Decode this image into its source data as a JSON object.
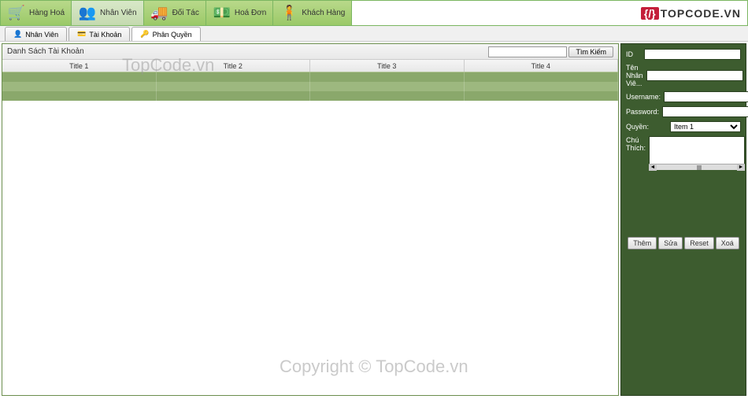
{
  "nav": {
    "items": [
      {
        "label": "Hàng Hoá",
        "icon": "🛒"
      },
      {
        "label": "Nhân Viên",
        "icon": "👥"
      },
      {
        "label": "Đối Tác",
        "icon": "🚚"
      },
      {
        "label": "Hoá Đơn",
        "icon": "💵"
      },
      {
        "label": "Khách Hàng",
        "icon": "🧍"
      }
    ]
  },
  "logo": {
    "bracket": "{/}",
    "text": "TOPCODE.VN"
  },
  "tabs": {
    "items": [
      {
        "label": "Nhân Viên"
      },
      {
        "label": "Tài Khoản"
      },
      {
        "label": "Phân Quyền"
      }
    ]
  },
  "panel": {
    "title": "Danh Sách Tài Khoản",
    "search_btn": "Tìm Kiếm",
    "columns": [
      "Title 1",
      "Title 2",
      "Title 3",
      "Title 4"
    ]
  },
  "form": {
    "id_label": "ID",
    "name_label": "Tên Nhân Viê...",
    "user_label": "Username:",
    "pass_label": "Password:",
    "role_label": "Quyền:",
    "role_value": "Item 1",
    "note_label": "Chú Thích:"
  },
  "buttons": {
    "add": "Thêm",
    "edit": "Sửa",
    "reset": "Reset",
    "delete": "Xoá"
  },
  "watermark": {
    "text1": "TopCode.vn",
    "text2": "Copyright © TopCode.vn"
  }
}
